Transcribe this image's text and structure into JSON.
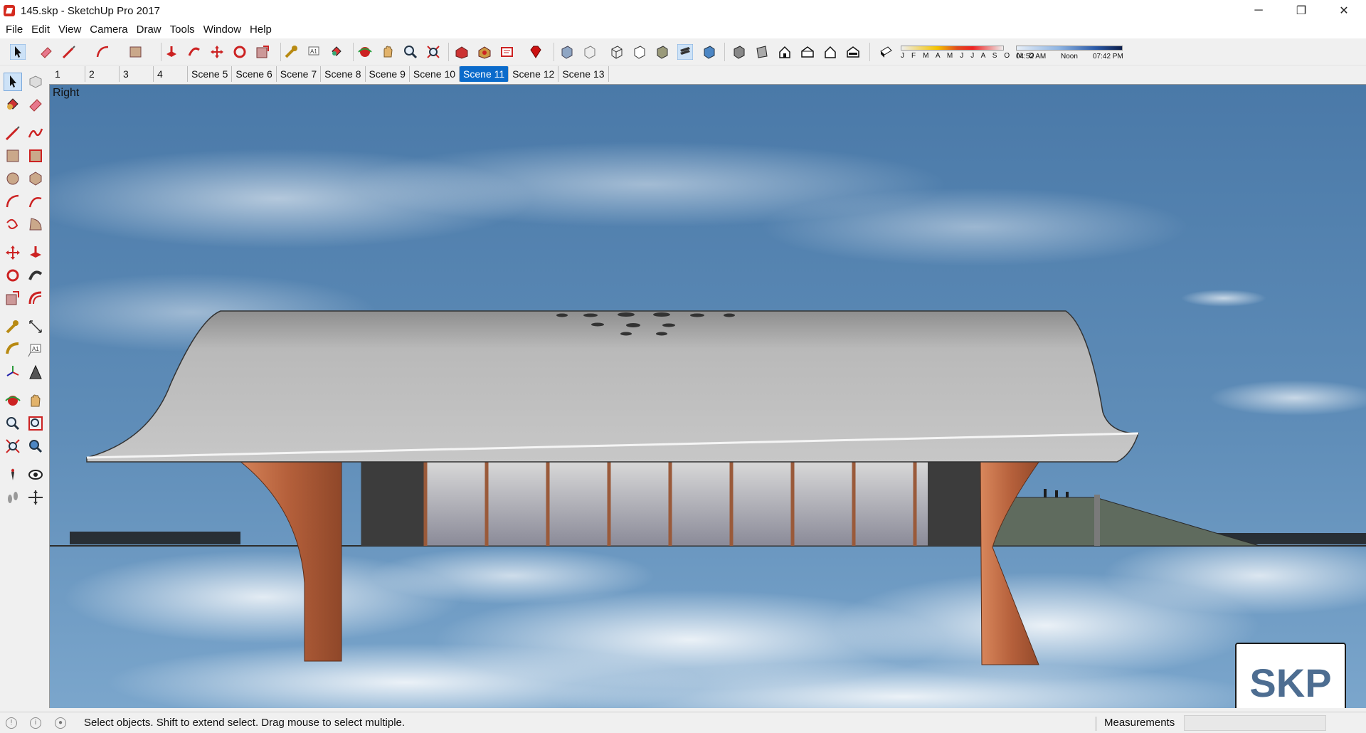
{
  "window": {
    "title": "145.skp - SketchUp Pro 2017",
    "minimize_glyph": "─",
    "maximize_glyph": "❐",
    "close_glyph": "✕"
  },
  "menu": [
    "File",
    "Edit",
    "View",
    "Camera",
    "Draw",
    "Tools",
    "Window",
    "Help"
  ],
  "shadow_settings": {
    "months": "J F M A M J J A S O N D",
    "time_start": "04:52 AM",
    "time_mid": "Noon",
    "time_end": "07:42 PM"
  },
  "scenes": {
    "tabs": [
      "1",
      "2",
      "3",
      "4",
      "Scene 5",
      "Scene 6",
      "Scene 7",
      "Scene 8",
      "Scene 9",
      "Scene 10",
      "Scene 11",
      "Scene 12",
      "Scene 13"
    ],
    "active": "Scene 11"
  },
  "viewport": {
    "view_name": "Right",
    "watermark": "SKP"
  },
  "status": {
    "text": "Select objects. Shift to extend select. Drag mouse to select multiple.",
    "measurements_label": "Measurements",
    "measurements_value": ""
  },
  "colors": {
    "accent": "#0b6bcb",
    "sky_top": "#4d7aa6",
    "roof": "#b5b5b5",
    "wood": "#b5603b",
    "logo_text": "#4d6d91"
  }
}
